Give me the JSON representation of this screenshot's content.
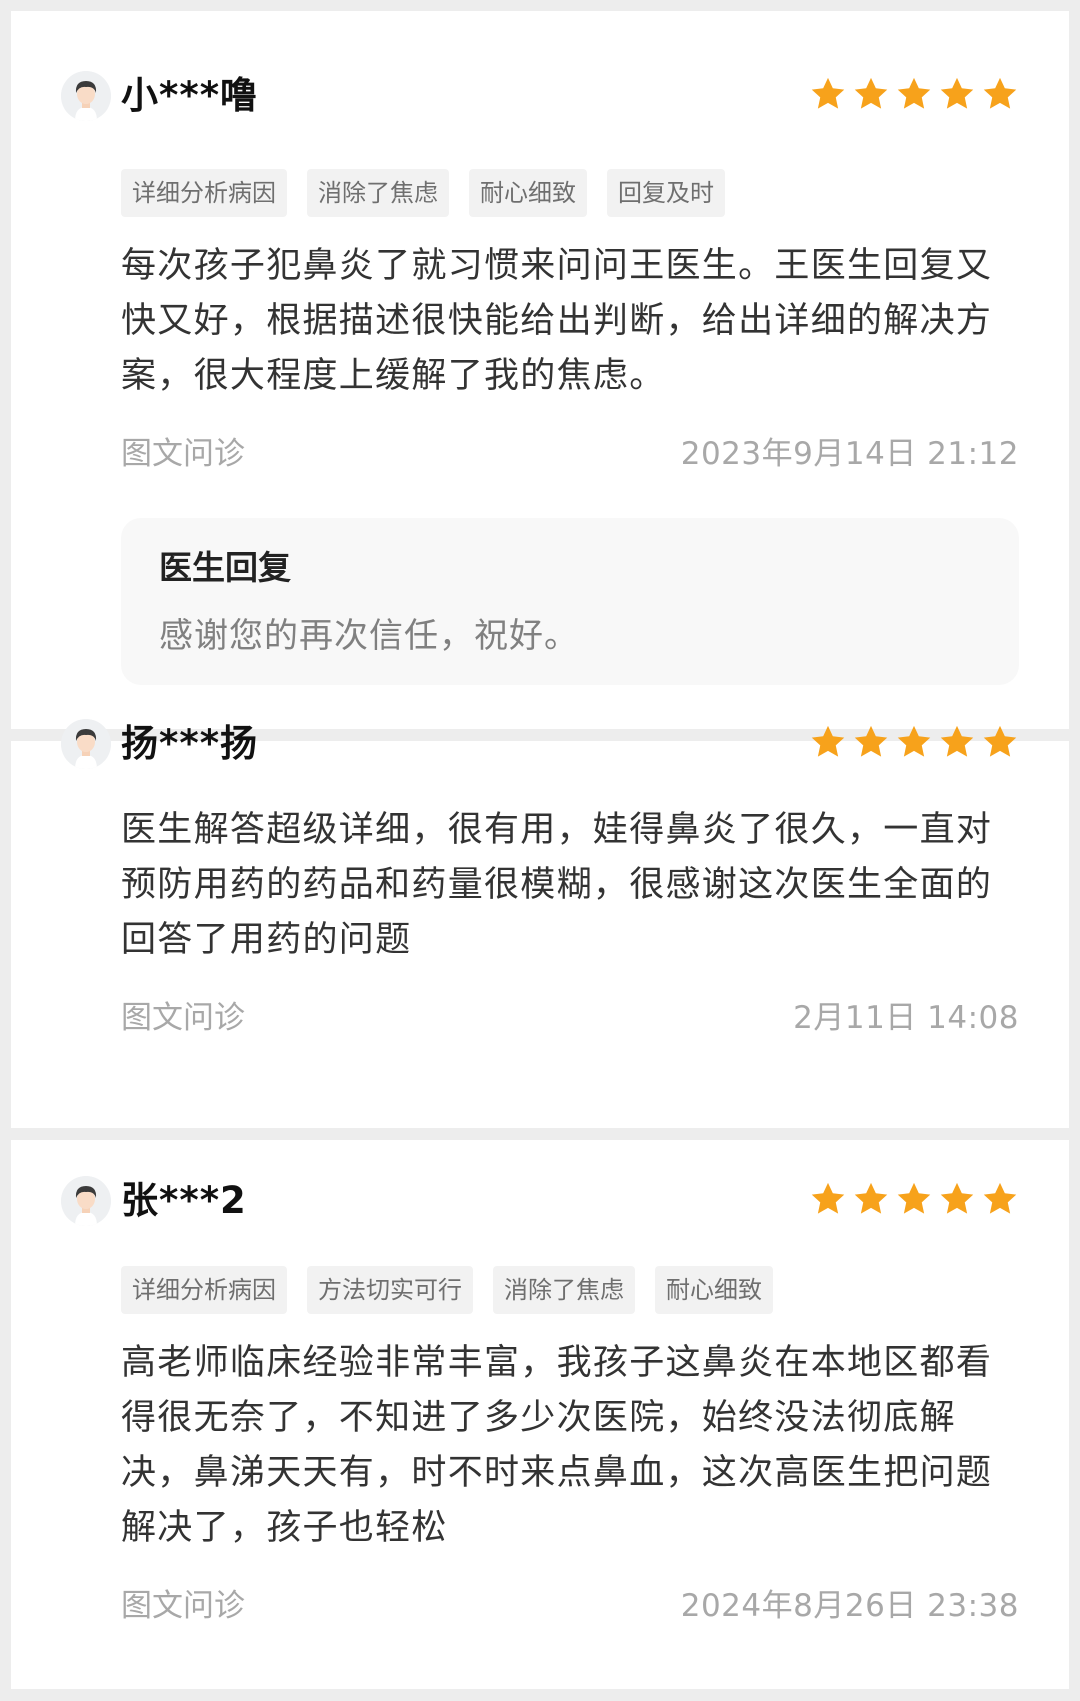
{
  "reviews": [
    {
      "user": "小***噜",
      "rating": 5,
      "tags": [
        "详细分析病因",
        "消除了焦虑",
        "耐心细致",
        "回复及时"
      ],
      "content": "每次孩子犯鼻炎了就习惯来问问王医生。王医生回复又快又好，根据描述很快能给出判断，给出详细的解决方案，很大程度上缓解了我的焦虑。",
      "service_type": "图文问诊",
      "timestamp": "2023年9月14日 21:12",
      "reply": {
        "title": "医生回复",
        "text": "感谢您的再次信任，祝好。"
      }
    },
    {
      "user": "扬***扬",
      "rating": 5,
      "tags": [],
      "content": "医生解答超级详细，很有用，娃得鼻炎了很久，一直对预防用药的药品和药量很模糊，很感谢这次医生全面的回答了用药的问题",
      "service_type": "图文问诊",
      "timestamp": "2月11日 14:08"
    },
    {
      "user": "张***2",
      "rating": 5,
      "tags": [
        "详细分析病因",
        "方法切实可行",
        "消除了焦虑",
        "耐心细致"
      ],
      "content": "高老师临床经验非常丰富，我孩子这鼻炎在本地区都看得很无奈了，不知进了多少次医院，始终没法彻底解决，鼻涕天天有，时不时来点鼻血，这次高医生把问题解决了，孩子也轻松",
      "service_type": "图文问诊",
      "timestamp": "2024年8月26日 23:38"
    }
  ],
  "icons": {
    "avatar": "avatar-icon",
    "star": "star-icon"
  },
  "colors": {
    "star": "#f7a21b",
    "background": "#ededed",
    "card": "#ffffff",
    "tag_bg": "#f2f2f2",
    "meta_text": "#a8a8a8"
  }
}
